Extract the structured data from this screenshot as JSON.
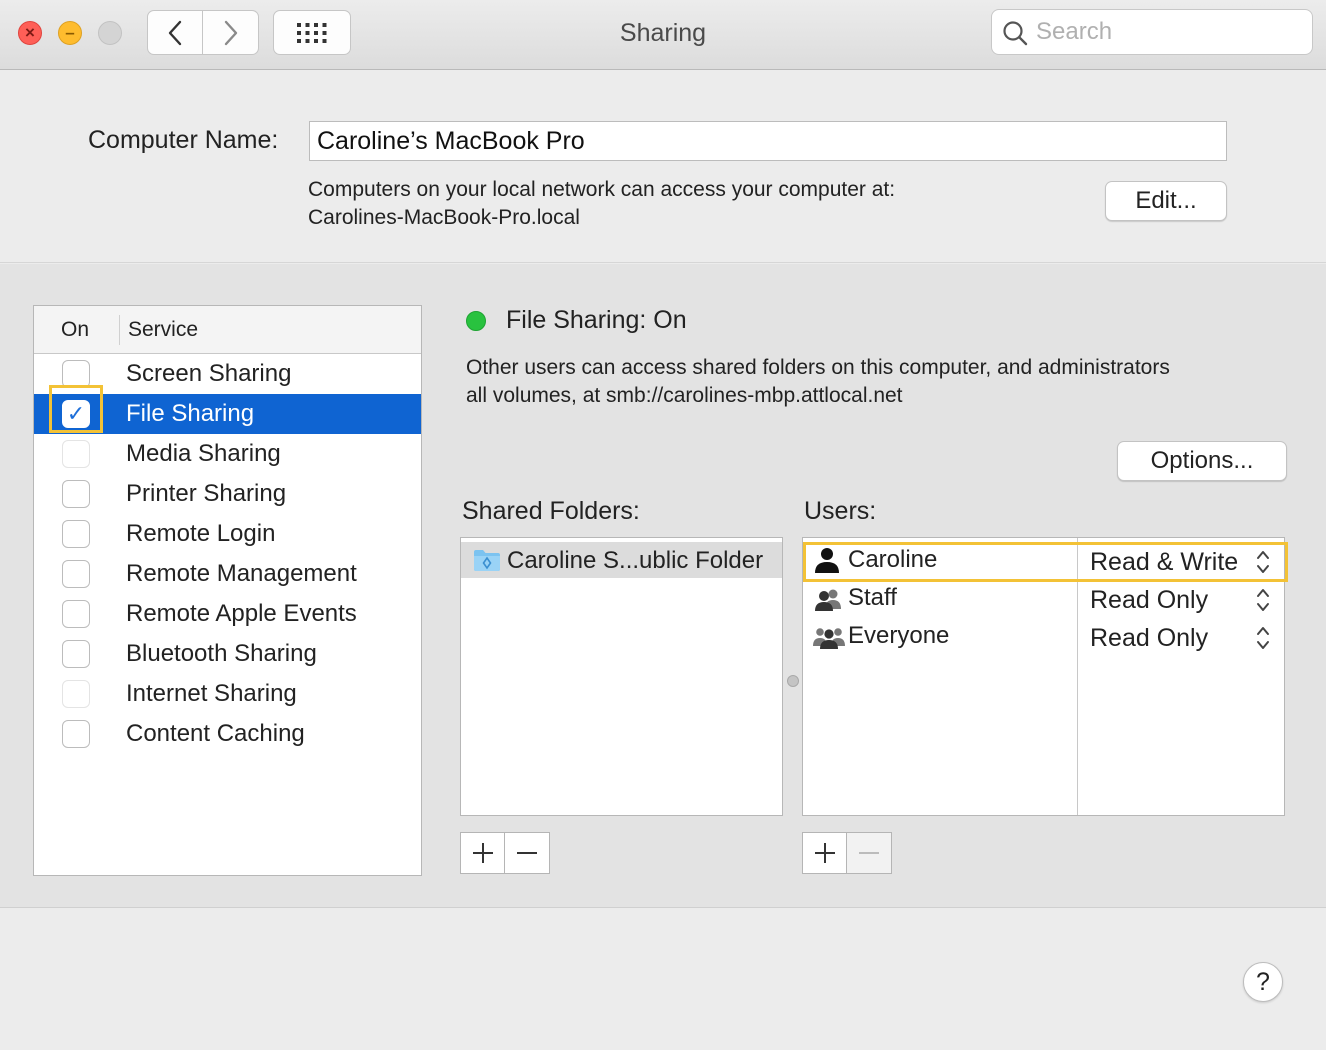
{
  "window": {
    "title": "Sharing",
    "search_placeholder": "Search"
  },
  "computer_name": {
    "label": "Computer Name:",
    "value": "Caroline’s MacBook Pro",
    "network_line1": "Computers on your local network can access your computer at:",
    "network_line2": "Carolines-MacBook-Pro.local",
    "edit_label": "Edit..."
  },
  "services": {
    "header_on": "On",
    "header_service": "Service",
    "items": [
      {
        "name": "Screen Sharing",
        "checked": false,
        "enabled": true
      },
      {
        "name": "File Sharing",
        "checked": true,
        "enabled": true,
        "selected": true
      },
      {
        "name": "Media Sharing",
        "checked": false,
        "enabled": false
      },
      {
        "name": "Printer Sharing",
        "checked": false,
        "enabled": true
      },
      {
        "name": "Remote Login",
        "checked": false,
        "enabled": true
      },
      {
        "name": "Remote Management",
        "checked": false,
        "enabled": true
      },
      {
        "name": "Remote Apple Events",
        "checked": false,
        "enabled": true
      },
      {
        "name": "Bluetooth Sharing",
        "checked": false,
        "enabled": true
      },
      {
        "name": "Internet Sharing",
        "checked": false,
        "enabled": false
      },
      {
        "name": "Content Caching",
        "checked": false,
        "enabled": true
      }
    ]
  },
  "detail": {
    "status": "File Sharing: On",
    "status_color": "#29c23f",
    "description_line1": "Other users can access shared folders on this computer, and administrators",
    "description_line2": "all volumes, at smb://carolines-mbp.attlocal.net",
    "options_label": "Options...",
    "shared_folders_label": "Shared Folders:",
    "users_label": "Users:",
    "folders": [
      {
        "name": "Caroline S...ublic Folder",
        "icon": "public-folder-icon"
      }
    ],
    "users": [
      {
        "name": "Caroline",
        "permission": "Read & Write",
        "icon": "single-user-icon"
      },
      {
        "name": "Staff",
        "permission": "Read Only",
        "icon": "group-icon"
      },
      {
        "name": "Everyone",
        "permission": "Read Only",
        "icon": "everyone-icon"
      }
    ]
  },
  "colors": {
    "selection": "#0f64d2",
    "highlight": "#f3c236"
  }
}
